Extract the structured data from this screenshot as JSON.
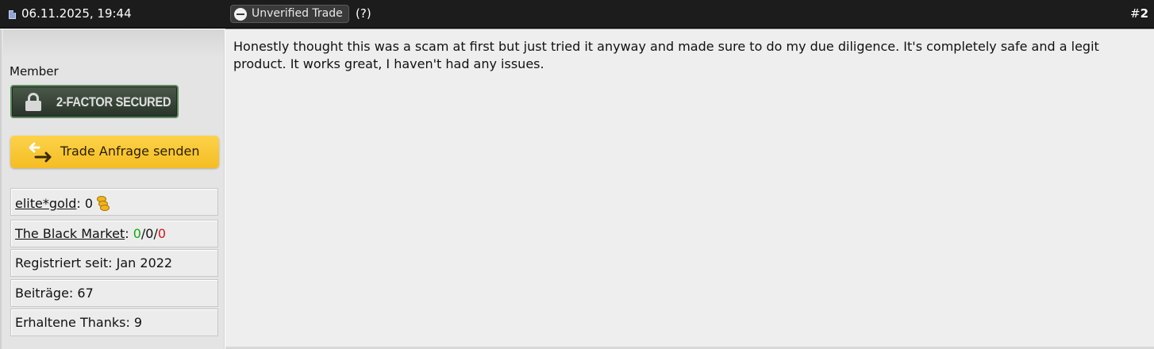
{
  "header": {
    "date": "06.11.2025, 19:44",
    "trade_status": "Unverified Trade",
    "trade_help": "(?)",
    "post_number_prefix": "#",
    "post_number": "2"
  },
  "user": {
    "title": "Member",
    "security_badge": "2-FACTOR SECURED",
    "trade_button": "Trade Anfrage senden",
    "stats": {
      "gold_label": "elite*gold",
      "gold_sep": ": ",
      "gold_value": "0",
      "market_label": "The Black Market",
      "market_sep": ": ",
      "market_positive": "0",
      "slash1": "/",
      "market_neutral": "0",
      "slash2": "/",
      "market_negative": "0",
      "registered": "Registriert seit: Jan 2022",
      "posts": "Beiträge: 67",
      "thanks": "Erhaltene Thanks: 9"
    }
  },
  "post": {
    "message": "Honestly thought this was a scam at first but just tried it anyway and made sure to do my due diligence. It's completely safe and a legit product. It works great, I haven't had any issues."
  },
  "icons": {
    "post": "post-icon",
    "trade_status": "minus-circle-icon",
    "lock": "lock-icon",
    "swap": "swap-arrows-icon",
    "coin": "gold-coins-icon"
  },
  "colors": {
    "header_bg": "#1c1c1c",
    "trade_button": "#f8c630",
    "positive": "#14a814",
    "negative": "#d81818"
  }
}
